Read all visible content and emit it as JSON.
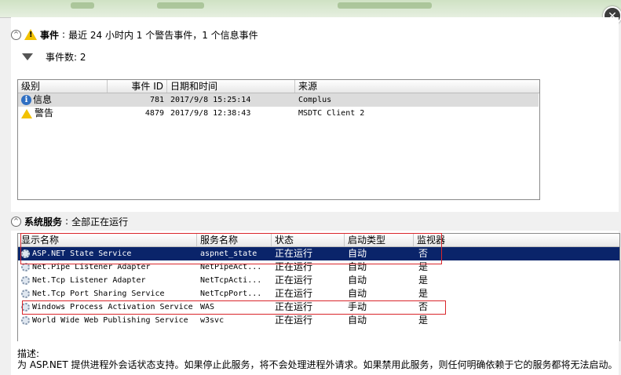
{
  "events": {
    "section_label": "事件",
    "summary": "最近 24 小时内 1 个警告事件，1 个信息事件",
    "filter_count": "事件数: 2",
    "columns": [
      "级别",
      "事件 ID",
      "日期和时间",
      "来源"
    ],
    "rows": [
      {
        "level": "信息",
        "level_icon": "info-icon",
        "event_id": "781",
        "datetime": "2017/9/8 15:25:14",
        "source": "Complus"
      },
      {
        "level": "警告",
        "level_icon": "warning-icon",
        "event_id": "4879",
        "datetime": "2017/9/8 12:38:43",
        "source": "MSDTC Client 2"
      }
    ]
  },
  "services": {
    "section_label": "系统服务",
    "summary": "全部正在运行",
    "columns": [
      "显示名称",
      "服务名称",
      "状态",
      "启动类型",
      "监视器"
    ],
    "rows": [
      {
        "display_name": "ASP.NET State Service",
        "service_name": "aspnet_state",
        "status": "正在运行",
        "startup": "自动",
        "monitor": "否",
        "selected": true
      },
      {
        "display_name": "Net.Pipe Listener Adapter",
        "service_name": "NetPipeAct...",
        "status": "正在运行",
        "startup": "自动",
        "monitor": "是"
      },
      {
        "display_name": "Net.Tcp Listener Adapter",
        "service_name": "NetTcpActi...",
        "status": "正在运行",
        "startup": "自动",
        "monitor": "是"
      },
      {
        "display_name": "Net.Tcp Port Sharing Service",
        "service_name": "NetTcpPort...",
        "status": "正在运行",
        "startup": "自动",
        "monitor": "是"
      },
      {
        "display_name": "Windows Process Activation Service",
        "service_name": "WAS",
        "status": "正在运行",
        "startup": "手动",
        "monitor": "否"
      },
      {
        "display_name": "World Wide Web Publishing Service",
        "service_name": "w3svc",
        "status": "正在运行",
        "startup": "自动",
        "monitor": "是"
      }
    ]
  },
  "description": {
    "label": "描述:",
    "text": "为 ASP.NET 提供进程外会话状态支持。如果停止此服务，将不会处理进程外请求。如果禁用此服务，则任何明确依赖于它的服务都将无法启动。"
  },
  "window": {
    "close_glyph": "✕"
  },
  "colors": {
    "selection": "#0a246a",
    "highlight_box": "#d9262b",
    "warning": "#f2c200",
    "info": "#2f6fc2"
  }
}
